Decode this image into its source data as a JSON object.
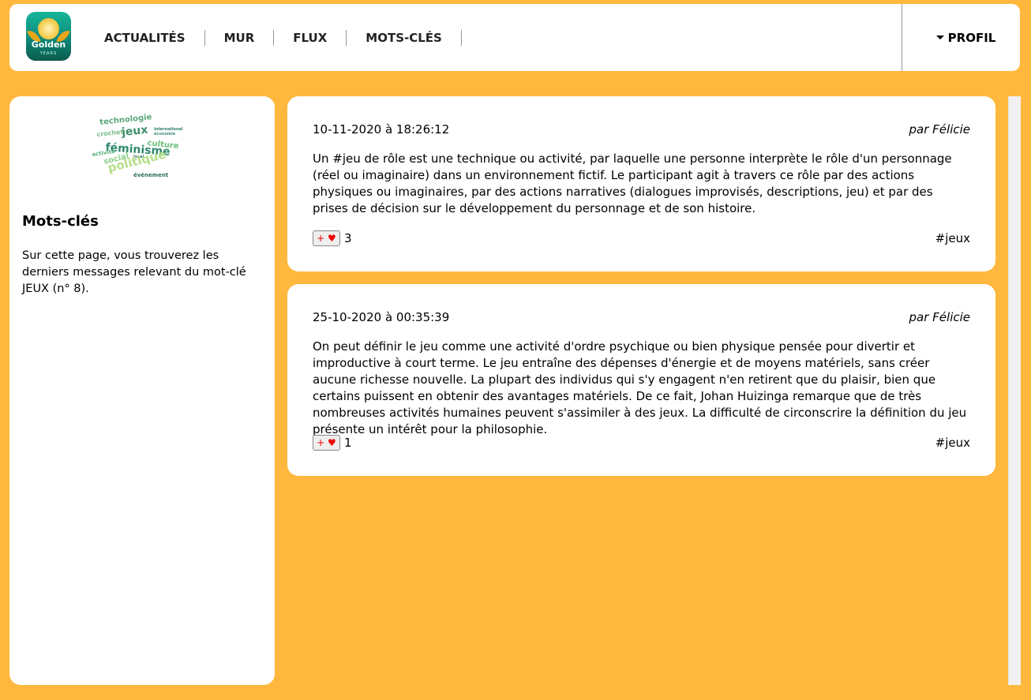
{
  "header": {
    "logo_text": "Golden",
    "logo_sub": "YEARS",
    "nav": [
      {
        "label": "ACTUALITÉS"
      },
      {
        "label": "MUR"
      },
      {
        "label": "FLUX"
      },
      {
        "label": "MOTS-CLÉS"
      }
    ],
    "profile_label": "PROFIL"
  },
  "sidebar": {
    "word_cloud": [
      {
        "word": "technologie",
        "color": "#5aa77a"
      },
      {
        "word": "international",
        "color": "#2e7d6b"
      },
      {
        "word": "crochet",
        "color": "#7cc08a"
      },
      {
        "word": "jeux",
        "color": "#3d8f6a"
      },
      {
        "word": "économie",
        "color": "#3f8f78"
      },
      {
        "word": "culture",
        "color": "#6bbf7a"
      },
      {
        "word": "féminisme",
        "color": "#2f8a6e"
      },
      {
        "word": "activité",
        "color": "#5ab07c"
      },
      {
        "word": "local",
        "color": "#3f7f6a"
      },
      {
        "word": "social",
        "color": "#8ccf8a"
      },
      {
        "word": "politique",
        "color": "#b5e08a"
      },
      {
        "word": "événement",
        "color": "#2e6e5e"
      }
    ],
    "title": "Mots-clés",
    "description": "Sur cette page, vous trouverez les derniers messages relevant du mot-clé JEUX (n° 8)."
  },
  "posts": [
    {
      "date": "10-11-2020 à 18:26:12",
      "author": "par Félicie",
      "body": "Un #jeu de rôle est une technique ou activité, par laquelle une personne interprète le rôle d'un personnage (réel ou imaginaire) dans un environnement fictif. Le participant agit à travers ce rôle par des actions physiques ou imaginaires, par des actions narratives (dialogues improvisés, descriptions, jeu) et par des prises de décision sur le développement du personnage et de son histoire.",
      "like_label": "+ ♥",
      "likes": "3",
      "tag": "#jeux"
    },
    {
      "date": "25-10-2020 à 00:35:39",
      "author": "par Félicie",
      "body": "On peut définir le jeu comme une activité d'ordre psychique ou bien physique pensée pour divertir et improductive à court terme. Le jeu entraîne des dépenses d'énergie et de moyens matériels, sans créer aucune richesse nouvelle. La plupart des individus qui s'y engagent n'en retirent que du plaisir, bien que certains puissent en obtenir des avantages matériels. De ce fait, Johan Huizinga remarque que de très nombreuses activités humaines peuvent s'assimiler à des jeux. La difficulté de circonscrire la définition du jeu présente un intérêt pour la philosophie.",
      "like_label": "+ ♥",
      "likes": "1",
      "tag": "#jeux"
    }
  ]
}
